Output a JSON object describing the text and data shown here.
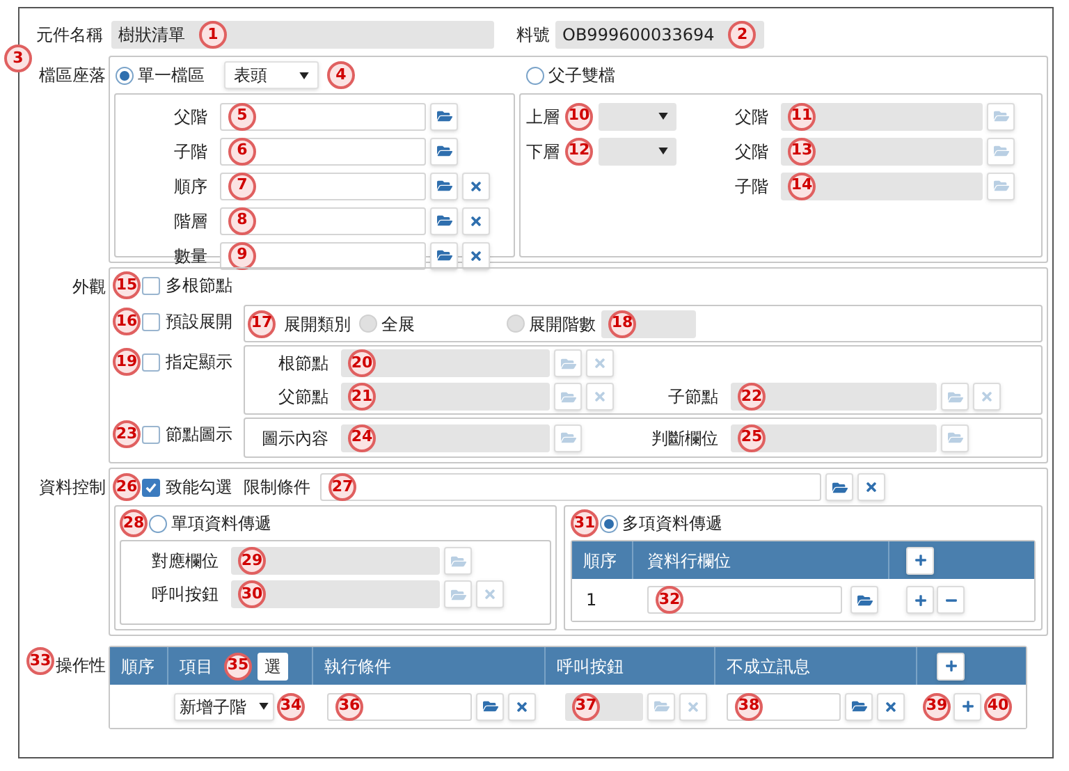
{
  "header": {
    "name_label": "元件名稱",
    "name_value": "樹狀清單",
    "code_label": "料號",
    "code_value": "OB999600033694"
  },
  "location": {
    "label": "檔區座落",
    "single": {
      "label": "單一檔區",
      "selected": true,
      "select": "表頭",
      "rows": [
        {
          "label": "父階",
          "clear": false
        },
        {
          "label": "子階",
          "clear": false
        },
        {
          "label": "順序",
          "clear": true
        },
        {
          "label": "階層",
          "clear": true
        },
        {
          "label": "數量",
          "clear": true
        }
      ]
    },
    "dual": {
      "label": "父子雙檔",
      "selected": false,
      "upper": "上層",
      "lower": "下層",
      "fields": [
        {
          "label": "父階"
        },
        {
          "label": "父階"
        },
        {
          "label": "子階"
        }
      ]
    }
  },
  "appearance": {
    "label": "外觀",
    "multi_root": {
      "label": "多根節點",
      "checked": false
    },
    "default_expand": {
      "label": "預設展開",
      "checked": false,
      "type_label": "展開類別",
      "options": [
        {
          "label": "全展",
          "selected": false,
          "kind": "radio"
        },
        {
          "label": "展開階數",
          "selected": false,
          "kind": "radio-field"
        }
      ]
    },
    "designated": {
      "label": "指定顯示",
      "checked": false,
      "fields": [
        {
          "label": "根節點"
        },
        {
          "label": "父節點"
        },
        {
          "label": "子節點"
        }
      ]
    },
    "node_icon": {
      "label": "節點圖示",
      "checked": false,
      "fields": [
        {
          "label": "圖示內容"
        },
        {
          "label": "判斷欄位"
        }
      ]
    }
  },
  "data_control": {
    "label": "資料控制",
    "enable_check": {
      "label": "致能勾選",
      "checked": true
    },
    "limit_label": "限制條件",
    "single": {
      "label": "單項資料傳遞",
      "selected": false,
      "fields": [
        {
          "label": "對應欄位",
          "clear": false
        },
        {
          "label": "呼叫按鈕",
          "clear": true
        }
      ]
    },
    "multi": {
      "label": "多項資料傳遞",
      "selected": true,
      "columns": [
        "順序",
        "資料行欄位"
      ],
      "rows": [
        {
          "order": "1"
        }
      ]
    }
  },
  "operations": {
    "label": "操作性",
    "columns": [
      "順序",
      "項目",
      "執行條件",
      "呼叫按鈕",
      "不成立訊息"
    ],
    "select_all": "選",
    "rows": [
      {
        "item": "新增子階",
        "call_button_disabled": true
      }
    ]
  },
  "markers": [
    "1",
    "2",
    "3",
    "4",
    "5",
    "6",
    "7",
    "8",
    "9",
    "10",
    "11",
    "12",
    "13",
    "14",
    "15",
    "16",
    "17",
    "18",
    "19",
    "20",
    "21",
    "22",
    "23",
    "24",
    "25",
    "26",
    "27",
    "28",
    "29",
    "30",
    "31",
    "32",
    "33",
    "34",
    "35",
    "36",
    "37",
    "38",
    "39",
    "40"
  ]
}
